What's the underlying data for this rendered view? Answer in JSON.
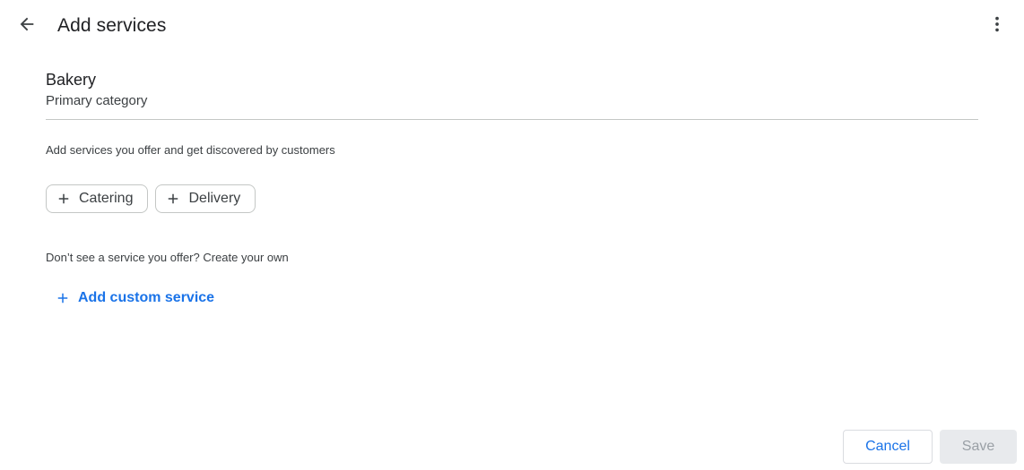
{
  "header": {
    "title": "Add services",
    "back_icon": "arrow-left-icon",
    "more_icon": "more-vert-icon"
  },
  "category": {
    "name": "Bakery",
    "label": "Primary category"
  },
  "suggestions": {
    "description": "Add services you offer and get discovered by customers",
    "chips": [
      {
        "label": "Catering",
        "icon": "plus-icon"
      },
      {
        "label": "Delivery",
        "icon": "plus-icon"
      }
    ]
  },
  "custom": {
    "description": "Don’t see a service you offer? Create your own",
    "add_label": "Add custom service",
    "add_icon": "plus-icon"
  },
  "footer": {
    "cancel_label": "Cancel",
    "save_label": "Save"
  },
  "colors": {
    "accent": "#1a73e8",
    "text": "#202124",
    "secondary_text": "#3c4043",
    "border": "#c4c7c5",
    "disabled_bg": "#e8eaed",
    "disabled_text": "#9aa0a6"
  }
}
